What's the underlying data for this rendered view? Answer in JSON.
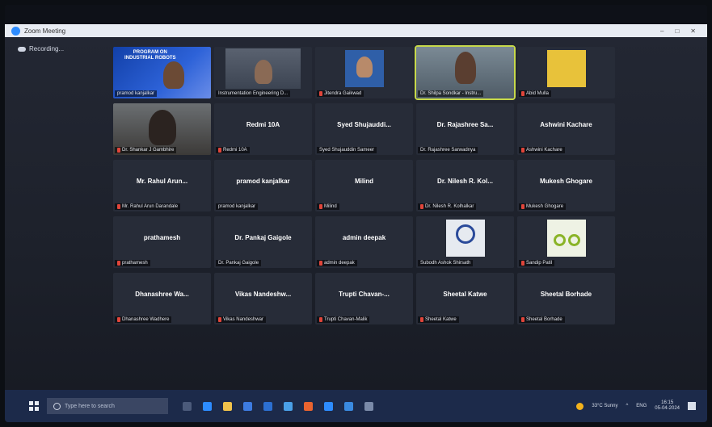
{
  "window": {
    "title": "Zoom Meeting",
    "recording_label": "Recording..."
  },
  "tiles": [
    {
      "label": "pramod kanjalkar",
      "mic_off": false,
      "video": "blue",
      "banner": "PROGRAM ON\nINDUSTRIAL ROBOTS"
    },
    {
      "label": "Instrumentation Engineering D...",
      "mic_off": false,
      "video": "office"
    },
    {
      "label": "Jitendra Gaikwad",
      "mic_off": true,
      "video": "portrait"
    },
    {
      "label": "Dr. Shilpa Sondkar - Instru...",
      "mic_off": false,
      "video": "room",
      "active": true
    },
    {
      "label": "Abid Mulla",
      "mic_off": true,
      "video": "yellow"
    },
    {
      "label": "Dr. Shankar J Gambhire",
      "mic_off": true,
      "video": "man"
    },
    {
      "name": "Redmi 10A",
      "label": "Redmi 10A",
      "mic_off": true
    },
    {
      "name": "Syed Shujauddi...",
      "label": "Syed Shujauddin Sameer",
      "mic_off": false
    },
    {
      "name": "Dr. Rajashree Sa...",
      "label": "Dr. Rajashree Sarwadnya",
      "mic_off": false
    },
    {
      "name": "Ashwini Kachare",
      "label": "Ashwini Kachare",
      "mic_off": true
    },
    {
      "name": "Mr. Rahul Arun...",
      "label": "Mr. Rahul Arun Darandale",
      "mic_off": true
    },
    {
      "name": "pramod kanjalkar",
      "label": "pramod kanjalkar",
      "mic_off": false
    },
    {
      "name": "Milind",
      "label": "Milind",
      "mic_off": true
    },
    {
      "name": "Dr. Nilesh R. Kol...",
      "label": "Dr. Nilesh R. Kolhalkar",
      "mic_off": true
    },
    {
      "name": "Mukesh Ghogare",
      "label": "Mukesh Ghogare",
      "mic_off": true
    },
    {
      "name": "prathamesh",
      "label": "prathamesh",
      "mic_off": true
    },
    {
      "name": "Dr. Pankaj Gaigole",
      "label": "Dr. Pankaj Gaigole",
      "mic_off": false
    },
    {
      "name": "admin deepak",
      "label": "admin deepak",
      "mic_off": true
    },
    {
      "label": "Subodh Ashok Shirsath",
      "mic_off": false,
      "video": "logo"
    },
    {
      "label": "Sandip Patil",
      "mic_off": true,
      "video": "cycle"
    },
    {
      "name": "Dhanashree Wa...",
      "label": "Dhanashree Wadhere",
      "mic_off": true
    },
    {
      "name": "Vikas Nandeshw...",
      "label": "Vikas Nandeshwar",
      "mic_off": true
    },
    {
      "name": "Trupti Chavan-...",
      "label": "Trupti Chavan-Malik",
      "mic_off": true
    },
    {
      "name": "Sheetal Katwe",
      "label": "Sheetal Katwe",
      "mic_off": true
    },
    {
      "name": "Sheetal Borhade",
      "label": "Sheetal Borhade",
      "mic_off": true
    }
  ],
  "taskbar": {
    "search_placeholder": "Type here to search",
    "weather": "33°C Sunny",
    "language": "ENG",
    "time": "16:15",
    "date": "05-04-2024"
  },
  "colors": {
    "active_speaker": "#c7d94a",
    "mic_off": "#e0453a",
    "zoom_blue": "#2d8cff"
  }
}
